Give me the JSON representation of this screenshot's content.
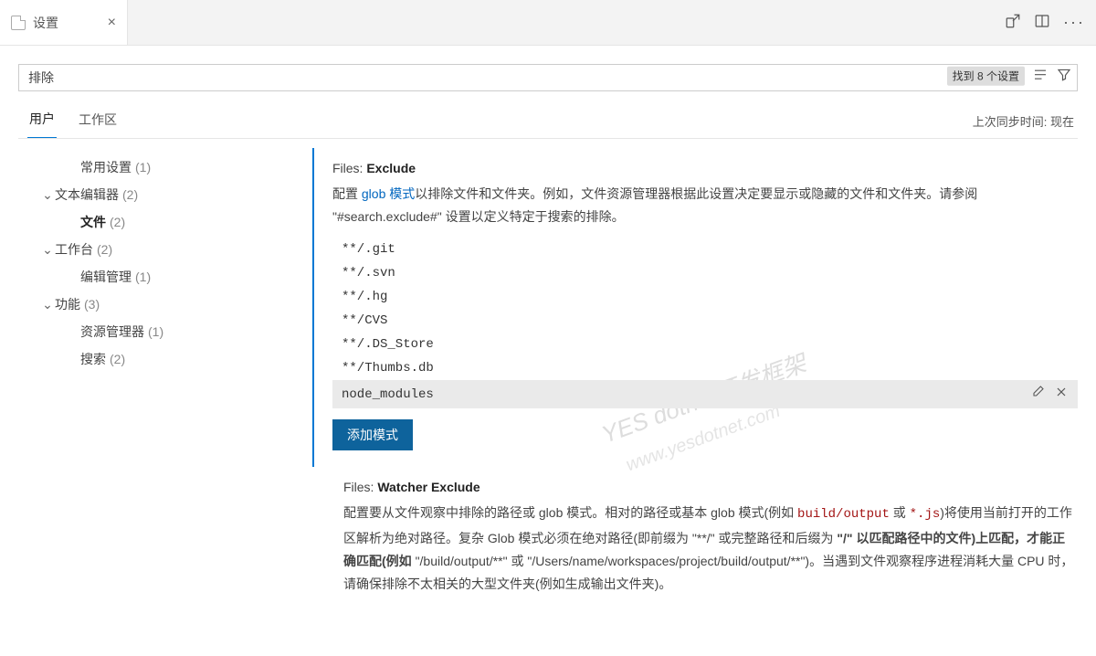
{
  "tab": {
    "title": "设置"
  },
  "search": {
    "value": "排除",
    "result_badge": "找到 8 个设置"
  },
  "scope": {
    "user": "用户",
    "workspace": "工作区",
    "sync": "上次同步时间: 现在"
  },
  "sidebar": {
    "items": [
      {
        "label": "常用设置",
        "count": "(1)",
        "level": "child"
      },
      {
        "label": "文本编辑器",
        "count": "(2)",
        "level": "top",
        "expandable": true
      },
      {
        "label": "文件",
        "count": "(2)",
        "level": "grandchild",
        "selected": true
      },
      {
        "label": "工作台",
        "count": "(2)",
        "level": "top",
        "expandable": true
      },
      {
        "label": "编辑管理",
        "count": "(1)",
        "level": "child"
      },
      {
        "label": "功能",
        "count": "(3)",
        "level": "top",
        "expandable": true
      },
      {
        "label": "资源管理器",
        "count": "(1)",
        "level": "child"
      },
      {
        "label": "搜索",
        "count": "(2)",
        "level": "child"
      }
    ]
  },
  "settings": {
    "filesExclude": {
      "titlePrefix": "Files: ",
      "titleBold": "Exclude",
      "desc_pre": "配置 ",
      "desc_link": "glob 模式",
      "desc_post": "以排除文件和文件夹。例如，文件资源管理器根据此设置决定要显示或隐藏的文件和文件夹。请参阅 \"#search.exclude#\" 设置以定义特定于搜索的排除。",
      "patterns": [
        "**/.git",
        "**/.svn",
        "**/.hg",
        "**/CVS",
        "**/.DS_Store",
        "**/Thumbs.db",
        "node_modules"
      ],
      "addButton": "添加模式"
    },
    "watcherExclude": {
      "titlePrefix": "Files: ",
      "titleBold": "Watcher Exclude",
      "desc_p1": "配置要从文件观察中排除的路径或 glob 模式。相对的路径或基本 glob 模式(例如 ",
      "code1": "build/output",
      "desc_p2": " 或 ",
      "code2": "*.js",
      "desc_p3": ")将使用当前打开的工作区解析为绝对路径。复杂 Glob 模式必须在绝对路径(即前缀为 \"**/\" 或完整路径和后缀为 ",
      "bold1": "\"/\" 以匹配路径中的文件)上匹配，才能正确匹配(例如 ",
      "desc_p4": "\"/build/output/**\" 或 \"/Users/name/workspaces/project/build/output/**\")。当遇到文件观察程序进程消耗大量 CPU 时，请确保排除不太相关的大型文件夹(例如生成输出文件夹)。"
    }
  },
  "watermark": {
    "line1": "YES dotnet开发框架",
    "line2": "www.yesdotnet.com"
  }
}
